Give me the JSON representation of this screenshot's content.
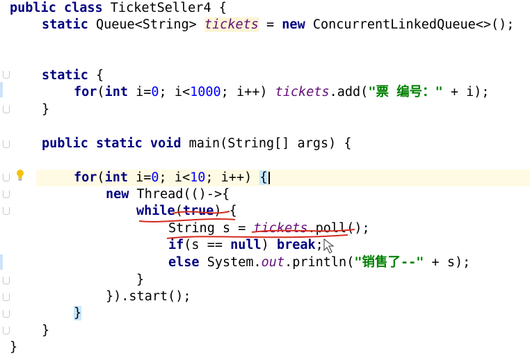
{
  "code": {
    "class_decl": {
      "kw": "public class",
      "name": " TicketSeller4 {"
    },
    "field": {
      "kw": "static",
      "type": " Queue<String> ",
      "name": "tickets",
      "eq": " = ",
      "new_kw": "new",
      "init": " ConcurrentLinkedQueue<>();"
    },
    "static_block": {
      "kw": "static",
      "open": " {"
    },
    "for1": {
      "for_kw": "for",
      "p1": "(",
      "int_kw": "int",
      "p2": " i=",
      "zero": "0",
      "p3": "; i<",
      "limit": "1000",
      "p4": "; i++) ",
      "fld": "tickets",
      "p5": ".add(",
      "str": "\"票 编号：\"",
      "p6": " + i);"
    },
    "close_brace": "}",
    "main_decl": {
      "kw": "public static void",
      "rest": " main(String[] args) {"
    },
    "for2": {
      "for_kw": "for",
      "p1": "(",
      "int_kw": "int",
      "p2": " i=",
      "zero": "0",
      "p3": "; i<",
      "limit": "10",
      "p4": "; i++) ",
      "brace": "{"
    },
    "thread": {
      "new_kw": "new",
      "rest": " Thread(()->{"
    },
    "while_line": {
      "kw": "while",
      "p1": "(",
      "true_kw": "true",
      "p2": ") {"
    },
    "poll_line": {
      "p1": "String s = ",
      "fld": "tickets",
      "p2": ".poll();"
    },
    "if_line": {
      "if_kw": "if",
      "p1": "(s == ",
      "null_kw": "null",
      "p2": ") ",
      "break_kw": "break",
      "p3": ";"
    },
    "else_line": {
      "else_kw": "else",
      "p1": " System.",
      "out_fld": "out",
      "p2": ".println(",
      "str": "\"销售了--\"",
      "p3": " + s);"
    },
    "inner_close": "}",
    "start_line": "}).start();",
    "brace_hl": "}",
    "main_close": "}",
    "class_close": "}"
  },
  "colors": {
    "keyword": "#000080",
    "field": "#660e7a",
    "number": "#0000ff",
    "string": "#008000",
    "caret_row": "#fffae3",
    "annotation_pen": "#d52b1e"
  },
  "icons": {
    "gutter": "lightbulb-icon"
  }
}
